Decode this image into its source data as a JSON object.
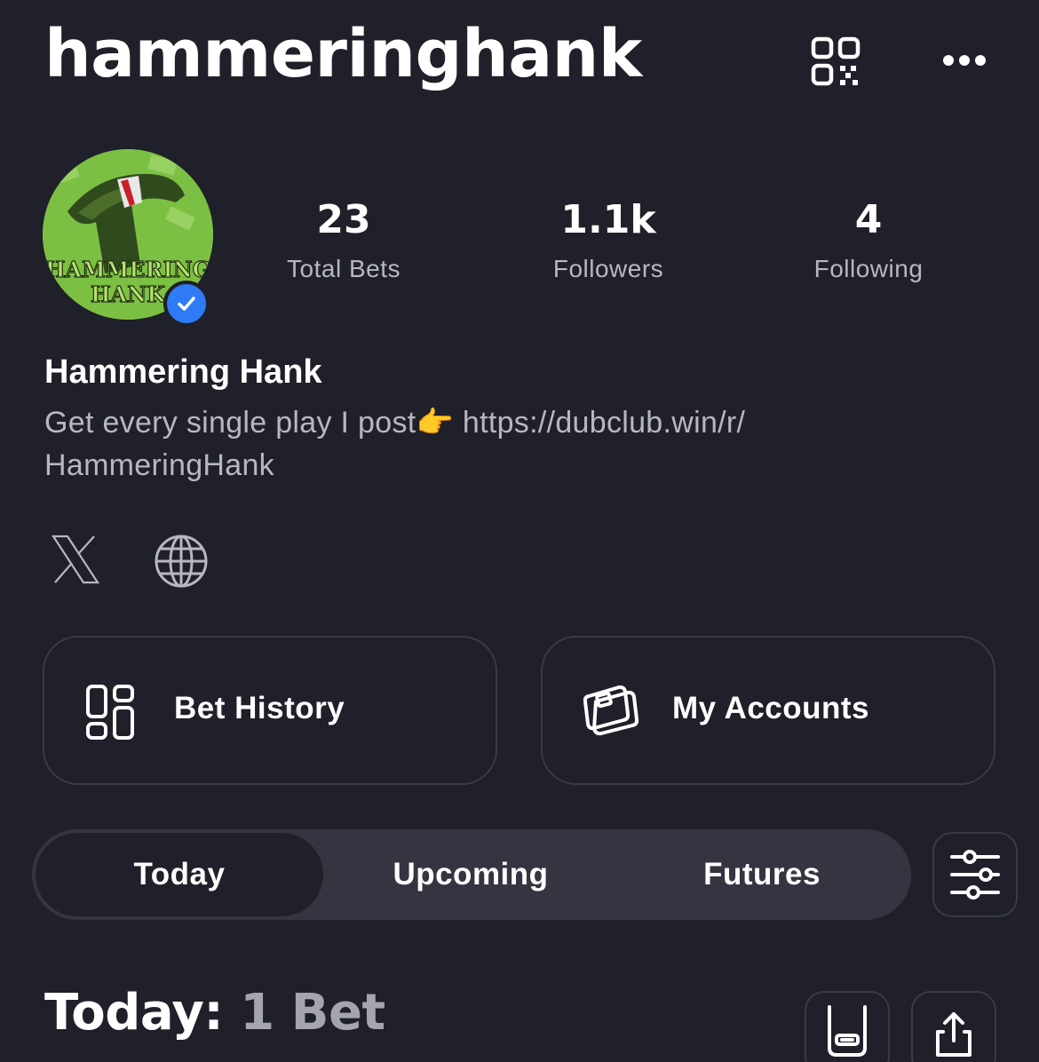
{
  "header": {
    "username": "hammeringhank",
    "qr_icon": "qr-code-icon",
    "more_icon": "more-horizontal-icon"
  },
  "profile": {
    "avatar_text": [
      "HAMMERING",
      "HANK"
    ],
    "verified": true,
    "display_name": "Hammering Hank",
    "bio_line1": "Get every single play I post👉 https://dubclub.win/r/",
    "bio_line2": "HammeringHank"
  },
  "stats": [
    {
      "value": "23",
      "label": "Total Bets"
    },
    {
      "value": "1.1k",
      "label": "Followers"
    },
    {
      "value": "4",
      "label": "Following"
    }
  ],
  "social": [
    {
      "icon": "x-logo-icon"
    },
    {
      "icon": "globe-icon"
    }
  ],
  "actions": {
    "bet_history": {
      "label": "Bet History",
      "icon": "dashboard-icon"
    },
    "my_accounts": {
      "label": "My Accounts",
      "icon": "wallet-cards-icon"
    }
  },
  "tabs": {
    "items": [
      "Today",
      "Upcoming",
      "Futures"
    ],
    "active": "Today",
    "filter_icon": "sliders-icon"
  },
  "section": {
    "title": "Today:",
    "count": "1 Bet",
    "bet_slip_icon": "bet-slip-icon",
    "share_icon": "share-icon"
  },
  "colors": {
    "background": "#1f2029",
    "card_border": "#3a3b45",
    "tab_track": "#343541",
    "muted_text": "#b7b8bf",
    "verified_blue": "#2f7bf5"
  }
}
